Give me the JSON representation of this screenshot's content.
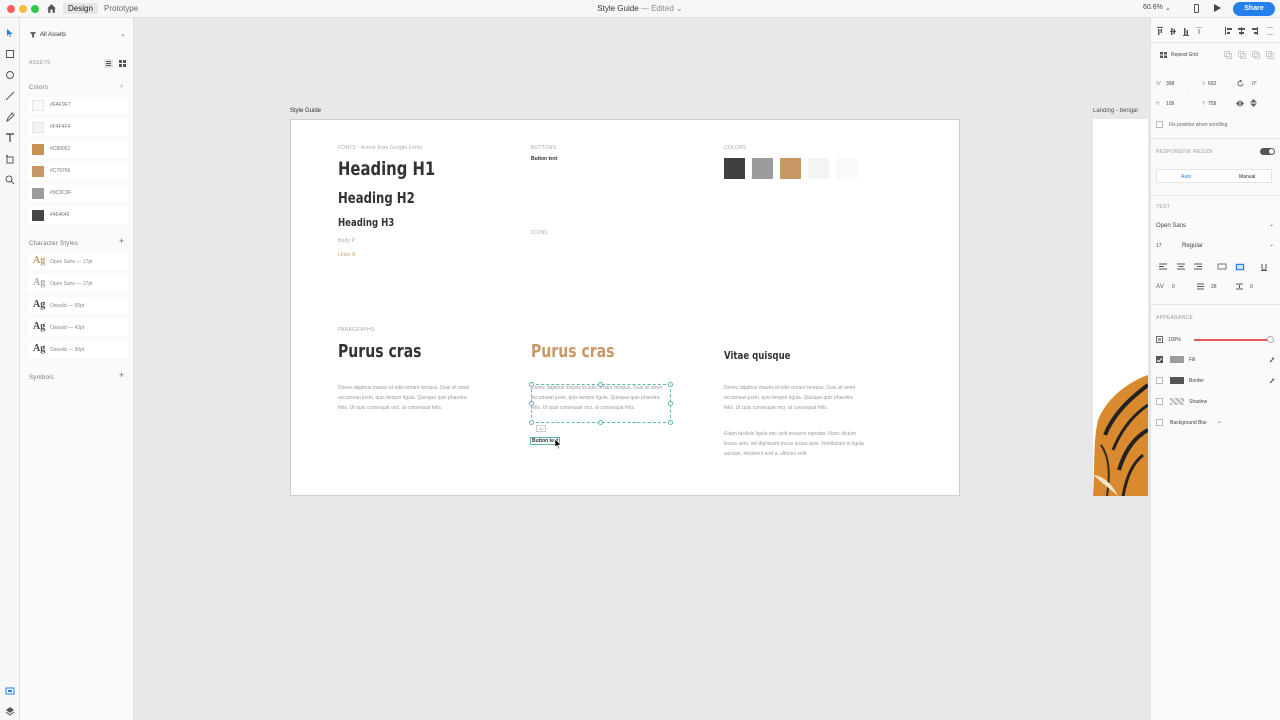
{
  "titlebar": {
    "tabs": [
      "Design",
      "Prototype"
    ],
    "doc_title": "Style Guide",
    "status": "— Edited",
    "zoom": "60.6%",
    "share_label": "Share"
  },
  "assets": {
    "filter": "All Assets",
    "section_assets": "ASSETS",
    "colors_title": "Colors",
    "colors": [
      {
        "hex": "#FAF9F7",
        "color": "#FAF9F7"
      },
      {
        "hex": "#F4F4F4",
        "color": "#F4F4F4"
      },
      {
        "hex": "#C89051",
        "color": "#C89051"
      },
      {
        "hex": "#C79766",
        "color": "#C79766"
      },
      {
        "hex": "#9C9C9F",
        "color": "#9C9C9F"
      },
      {
        "hex": "#464646",
        "color": "#464646"
      }
    ],
    "character_styles_title": "Character Styles",
    "character_styles": [
      {
        "glyph": "Ag",
        "name": "Open Sans — 17pt",
        "color": "#C79766"
      },
      {
        "glyph": "Ag",
        "name": "Open Sans — 17pt",
        "color": "#aaaaaa"
      },
      {
        "glyph": "Ag",
        "name": "Oswald — 50pt",
        "color": "#444444"
      },
      {
        "glyph": "Ag",
        "name": "Oswald — 42pt",
        "color": "#444444"
      },
      {
        "glyph": "Ag",
        "name": "Oswald — 30pt",
        "color": "#444444"
      }
    ],
    "symbols_title": "Symbols"
  },
  "canvas": {
    "artboard_label": "Style Guide",
    "artboard2_label": "Landing - bengal",
    "fonts_label": "FONTS - Avenir from Google Fonts",
    "h1": "Heading H1",
    "h2": "Heading H2",
    "h3": "Heading H3",
    "body_p": "Body P",
    "links_a": "Links A",
    "buttons_label": "BUTTONS",
    "button_text": "Button text",
    "icons_label": "ICONS",
    "colors_label": "COLORS",
    "swatches": [
      "#404040",
      "#9C9C9F",
      "#C79766",
      "#F4F4F4",
      "#FAF9F7"
    ],
    "paragraphs_label": "PARAGRAPHS",
    "para_head_1": "Purus cras",
    "para_head_2": "Purus cras",
    "para_head_3": "Vitae quisque",
    "para_text_1": "Donec dapibus mauris id odio ornare tempus. Duis sit amet accumsan justo, quis tempor ligula. Quisque quis pharetra felis. Ut quis consequat orci, at consequat felis.",
    "para_text_2": "Donec dapibus mauris id odio ornare tempus. Duis sit amet accumsan justo, quis tempor ligula. Quisque quis pharetra felis. Ut quis consequat orci, at consequat felis.",
    "para_text_3a": "Donec dapibus mauris id odio ornare tempus. Duis sit amet accumsan justo, quis tempor ligula. Quisque quis pharetra felis. Ut quis consequat orci, at consequat felis.",
    "para_text_3b": "Etiam facilisis ligula nec velit posuere egestas. Nunc dictum lectus sem, vel dignissim purus luctus quis. Vestibulum in ligula suscipit, hendrerit erat a, ultrices velit.",
    "selection_tag": "40",
    "selected_button": "Button text"
  },
  "inspector": {
    "repeat_grid": "Repeat Grid",
    "w_label": "W",
    "w_value": "398",
    "x_label": "X",
    "x_value": "692",
    "rot_value": "0°",
    "h_label": "H",
    "h_value": "109",
    "y_label": "Y",
    "y_value": "759",
    "fix_position": "Fix position when scrolling",
    "responsive_resize": "RESPONSIVE RESIZE",
    "auto": "Auto",
    "manual": "Manual",
    "text_label": "TEXT",
    "font": "Open Sans",
    "size": "17",
    "weight": "Regular",
    "char_spacing": "0",
    "line_spacing": "28",
    "para_spacing": "0",
    "appearance_label": "APPEARANCE",
    "opacity": "100%",
    "opacity_level": 1.0,
    "fill": "Fill",
    "border": "Border",
    "shadow": "Shadow",
    "background_blur": "Background Blur",
    "fill_color": "#9C9C9F",
    "border_color": "#555555",
    "fill_checked": true,
    "border_checked": false,
    "shadow_checked": false,
    "blur_checked": false
  }
}
